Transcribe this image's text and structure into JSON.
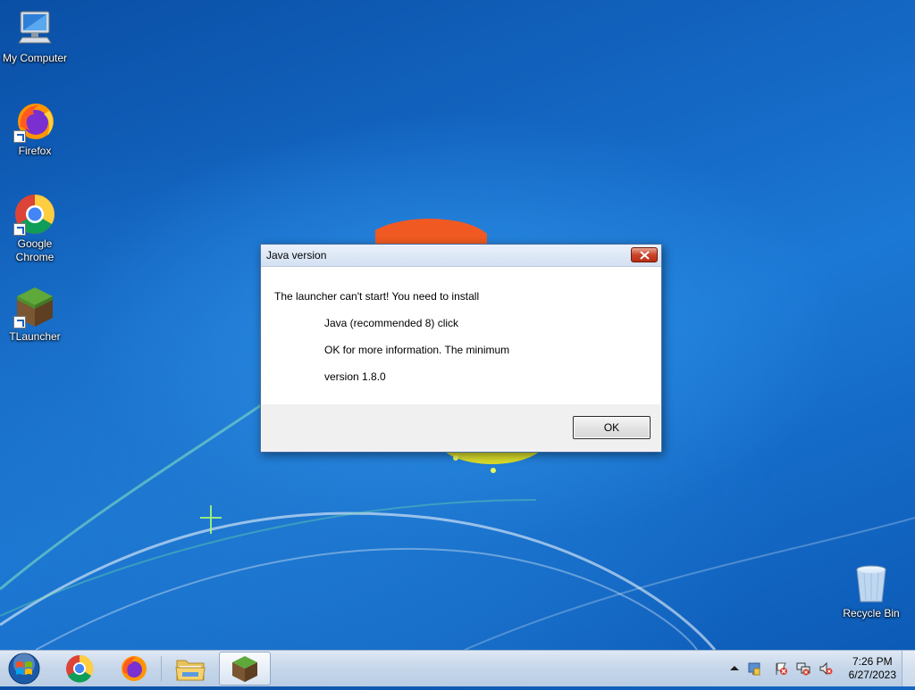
{
  "desktop": {
    "icons": [
      {
        "label": "My Computer",
        "icon": "computer-icon"
      },
      {
        "label": "Firefox",
        "icon": "firefox-icon"
      },
      {
        "label": "Google Chrome",
        "icon": "chrome-icon"
      },
      {
        "label": "TLauncher",
        "icon": "tlauncher-icon"
      },
      {
        "label": "Recycle Bin",
        "icon": "recycle-bin-icon"
      }
    ]
  },
  "dialog": {
    "title": "Java version",
    "lines": [
      "The launcher can't start! You need to install",
      "Java (recommended 8) click",
      "OK for more information. The minimum",
      "version 1.8.0"
    ],
    "ok_label": "OK"
  },
  "taskbar": {
    "items": [
      "start-orb",
      "chrome",
      "firefox",
      "file-explorer",
      "tlauncher"
    ],
    "active_item": "tlauncher",
    "clock": {
      "time": "7:26 PM",
      "date": "6/27/2023"
    }
  },
  "colors": {
    "wallpaper": "#1468c4",
    "taskbar": "#c7d7ea",
    "dialog_border": "#4a6ea3"
  }
}
